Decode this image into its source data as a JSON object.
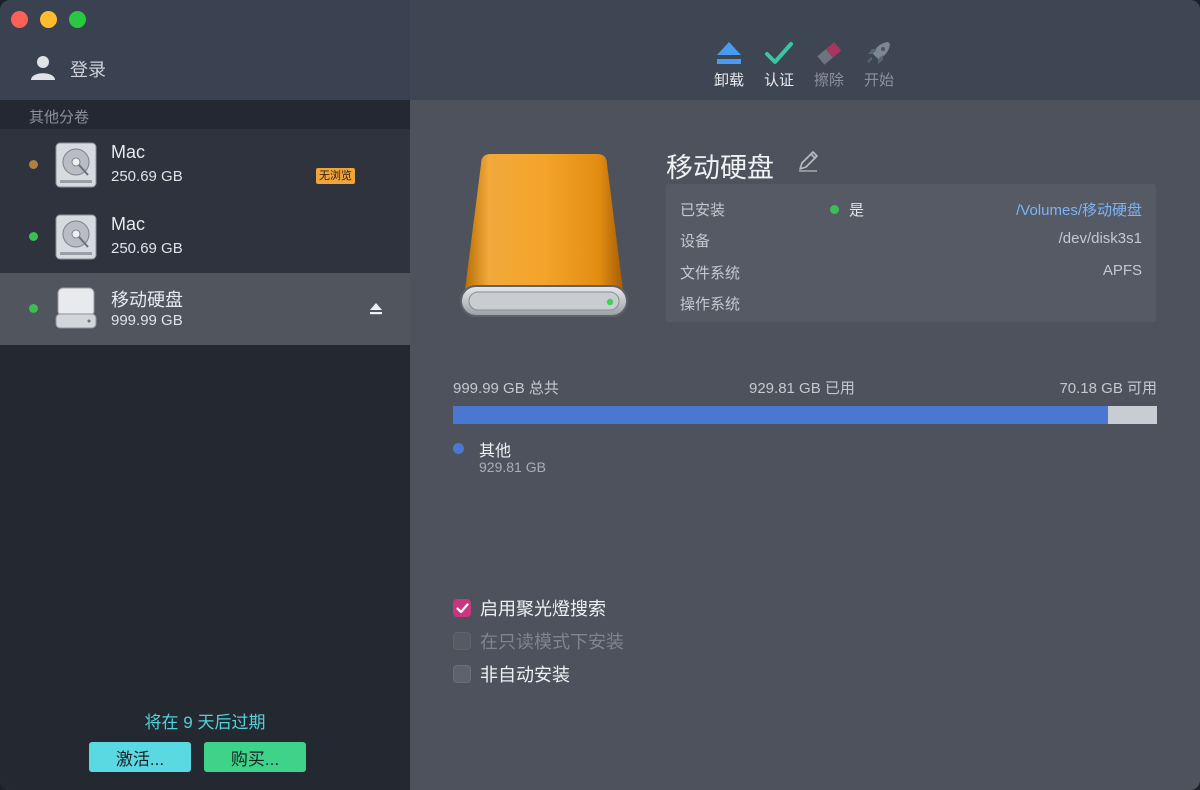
{
  "sidebar": {
    "login_label": "登录",
    "section_label": "其他分卷",
    "volumes": [
      {
        "name": "Mac",
        "size": "250.69 GB",
        "badge": "无浏览",
        "status_color": "#b08040"
      },
      {
        "name": "Mac",
        "size": "250.69 GB",
        "status_color": "#3bbf52"
      },
      {
        "name": "移动硬盘",
        "size": "999.99 GB",
        "status_color": "#3bbf52"
      }
    ],
    "expire_text": "将在 9 天后过期",
    "activate_label": "激活...",
    "buy_label": "购买..."
  },
  "toolbar": {
    "items": [
      {
        "label": "卸载",
        "icon": "eject-icon",
        "enabled": true
      },
      {
        "label": "认证",
        "icon": "checkmark-icon",
        "enabled": true
      },
      {
        "label": "擦除",
        "icon": "eraser-icon",
        "enabled": false
      },
      {
        "label": "开始",
        "icon": "rocket-icon",
        "enabled": false
      }
    ]
  },
  "disk": {
    "title": "移动硬盘",
    "info": {
      "mounted_key": "已安装",
      "mounted_value": "是",
      "mount_path": "/Volumes/移动硬盘",
      "device_key": "设备",
      "device_value": "/dev/disk3s1",
      "fs_key": "文件系统",
      "fs_value": "APFS",
      "os_key": "操作系统",
      "os_value": ""
    }
  },
  "usage": {
    "total_label": "999.99 GB 总共",
    "used_label": "929.81 GB 已用",
    "free_label": "70.18 GB 可用",
    "used_fraction": 0.93,
    "legend_name": "其他",
    "legend_size": "929.81 GB"
  },
  "options": [
    {
      "label": "启用聚光燈搜索",
      "checked": true,
      "enabled": true
    },
    {
      "label": "在只读模式下安装",
      "checked": false,
      "enabled": false
    },
    {
      "label": "非自动安装",
      "checked": false,
      "enabled": true
    }
  ],
  "colors": {
    "accent_blue": "#4a77d2",
    "checkbox_pink": "#c9357f",
    "status_green": "#3bbf52",
    "activate_cyan": "#5ad9e3",
    "buy_green": "#3fd38a"
  }
}
